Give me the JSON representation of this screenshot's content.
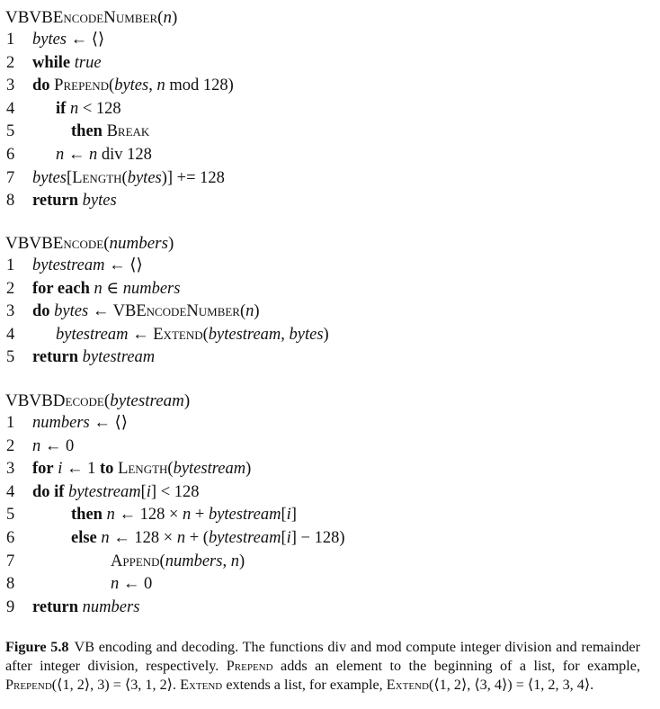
{
  "algorithms": [
    {
      "title_name": "VBEncodeNumber",
      "title_arg": "n",
      "lines": [
        {
          "num": "1",
          "indent": 0,
          "parts": [
            {
              "t": "bytes",
              "s": "it"
            },
            {
              "t": " ← ⟨⟩",
              "s": ""
            }
          ]
        },
        {
          "num": "2",
          "indent": 0,
          "parts": [
            {
              "t": "while",
              "s": "kw"
            },
            {
              "t": " ",
              "s": ""
            },
            {
              "t": "true",
              "s": "it"
            }
          ]
        },
        {
          "num": "3",
          "indent": 0,
          "parts": [
            {
              "t": "do",
              "s": "kw"
            },
            {
              "t": " ",
              "s": ""
            },
            {
              "t": "Prepend",
              "s": "sc"
            },
            {
              "t": "(",
              "s": ""
            },
            {
              "t": "bytes",
              "s": "it"
            },
            {
              "t": ", ",
              "s": ""
            },
            {
              "t": "n",
              "s": "it"
            },
            {
              "t": " mod 128)",
              "s": ""
            }
          ]
        },
        {
          "num": "4",
          "indent": 1,
          "parts": [
            {
              "t": "if",
              "s": "kw"
            },
            {
              "t": " ",
              "s": ""
            },
            {
              "t": "n",
              "s": "it"
            },
            {
              "t": " < 128",
              "s": ""
            }
          ]
        },
        {
          "num": "5",
          "indent": 2,
          "parts": [
            {
              "t": "then",
              "s": "kw"
            },
            {
              "t": " ",
              "s": ""
            },
            {
              "t": "Break",
              "s": "sc"
            }
          ]
        },
        {
          "num": "6",
          "indent": 1,
          "parts": [
            {
              "t": "n",
              "s": "it"
            },
            {
              "t": " ← ",
              "s": ""
            },
            {
              "t": "n",
              "s": "it"
            },
            {
              "t": " div 128",
              "s": ""
            }
          ]
        },
        {
          "num": "7",
          "indent": 0,
          "parts": [
            {
              "t": "bytes",
              "s": "it"
            },
            {
              "t": "[",
              "s": ""
            },
            {
              "t": "Length",
              "s": "sc"
            },
            {
              "t": "(",
              "s": ""
            },
            {
              "t": "bytes",
              "s": "it"
            },
            {
              "t": ")] += 128",
              "s": ""
            }
          ]
        },
        {
          "num": "8",
          "indent": 0,
          "parts": [
            {
              "t": "return",
              "s": "kw"
            },
            {
              "t": " ",
              "s": ""
            },
            {
              "t": "bytes",
              "s": "it"
            }
          ]
        }
      ]
    },
    {
      "title_name": "VBEncode",
      "title_arg": "numbers",
      "lines": [
        {
          "num": "1",
          "indent": 0,
          "parts": [
            {
              "t": "bytestream",
              "s": "it"
            },
            {
              "t": " ← ⟨⟩",
              "s": ""
            }
          ]
        },
        {
          "num": "2",
          "indent": 0,
          "parts": [
            {
              "t": "for each",
              "s": "kw"
            },
            {
              "t": " ",
              "s": ""
            },
            {
              "t": "n",
              "s": "it"
            },
            {
              "t": " ∈ ",
              "s": ""
            },
            {
              "t": "numbers",
              "s": "it"
            }
          ]
        },
        {
          "num": "3",
          "indent": 0,
          "parts": [
            {
              "t": "do",
              "s": "kw"
            },
            {
              "t": " ",
              "s": ""
            },
            {
              "t": "bytes",
              "s": "it"
            },
            {
              "t": " ← VB",
              "s": ""
            },
            {
              "t": "EncodeNumber",
              "s": "sc"
            },
            {
              "t": "(",
              "s": ""
            },
            {
              "t": "n",
              "s": "it"
            },
            {
              "t": ")",
              "s": ""
            }
          ]
        },
        {
          "num": "4",
          "indent": 1,
          "parts": [
            {
              "t": "bytestream",
              "s": "it"
            },
            {
              "t": " ← ",
              "s": ""
            },
            {
              "t": "Extend",
              "s": "sc"
            },
            {
              "t": "(",
              "s": ""
            },
            {
              "t": "bytestream",
              "s": "it"
            },
            {
              "t": ", ",
              "s": ""
            },
            {
              "t": "bytes",
              "s": "it"
            },
            {
              "t": ")",
              "s": ""
            }
          ]
        },
        {
          "num": "5",
          "indent": 0,
          "parts": [
            {
              "t": "return",
              "s": "kw"
            },
            {
              "t": " ",
              "s": ""
            },
            {
              "t": "bytestream",
              "s": "it"
            }
          ]
        }
      ]
    },
    {
      "title_name": "VBDecode",
      "title_arg": "bytestream",
      "lines": [
        {
          "num": "1",
          "indent": 0,
          "parts": [
            {
              "t": "numbers",
              "s": "it"
            },
            {
              "t": " ← ⟨⟩",
              "s": ""
            }
          ]
        },
        {
          "num": "2",
          "indent": 0,
          "parts": [
            {
              "t": "n",
              "s": "it"
            },
            {
              "t": " ← 0",
              "s": ""
            }
          ]
        },
        {
          "num": "3",
          "indent": 0,
          "parts": [
            {
              "t": "for",
              "s": "kw"
            },
            {
              "t": " ",
              "s": ""
            },
            {
              "t": "i",
              "s": "it"
            },
            {
              "t": " ← 1 ",
              "s": ""
            },
            {
              "t": "to",
              "s": "kw"
            },
            {
              "t": " ",
              "s": ""
            },
            {
              "t": "Length",
              "s": "sc"
            },
            {
              "t": "(",
              "s": ""
            },
            {
              "t": "bytestream",
              "s": "it"
            },
            {
              "t": ")",
              "s": ""
            }
          ]
        },
        {
          "num": "4",
          "indent": 0,
          "parts": [
            {
              "t": "do if",
              "s": "kw"
            },
            {
              "t": " ",
              "s": ""
            },
            {
              "t": "bytestream",
              "s": "it"
            },
            {
              "t": "[",
              "s": ""
            },
            {
              "t": "i",
              "s": "it"
            },
            {
              "t": "] < 128",
              "s": ""
            }
          ]
        },
        {
          "num": "5",
          "indent": 2,
          "parts": [
            {
              "t": "then",
              "s": "kw"
            },
            {
              "t": " ",
              "s": ""
            },
            {
              "t": "n",
              "s": "it"
            },
            {
              "t": " ← 128 × ",
              "s": ""
            },
            {
              "t": "n",
              "s": "it"
            },
            {
              "t": " + ",
              "s": ""
            },
            {
              "t": "bytestream",
              "s": "it"
            },
            {
              "t": "[",
              "s": ""
            },
            {
              "t": "i",
              "s": "it"
            },
            {
              "t": "]",
              "s": ""
            }
          ]
        },
        {
          "num": "6",
          "indent": 2,
          "parts": [
            {
              "t": "else",
              "s": "kw"
            },
            {
              "t": " ",
              "s": ""
            },
            {
              "t": "n",
              "s": "it"
            },
            {
              "t": " ← 128 × ",
              "s": ""
            },
            {
              "t": "n",
              "s": "it"
            },
            {
              "t": " + (",
              "s": ""
            },
            {
              "t": "bytestream",
              "s": "it"
            },
            {
              "t": "[",
              "s": ""
            },
            {
              "t": "i",
              "s": "it"
            },
            {
              "t": "] − 128)",
              "s": ""
            }
          ]
        },
        {
          "num": "7",
          "indent": 3,
          "parts": [
            {
              "t": "Append",
              "s": "sc"
            },
            {
              "t": "(",
              "s": ""
            },
            {
              "t": "numbers",
              "s": "it"
            },
            {
              "t": ", ",
              "s": ""
            },
            {
              "t": "n",
              "s": "it"
            },
            {
              "t": ")",
              "s": ""
            }
          ]
        },
        {
          "num": "8",
          "indent": 3,
          "parts": [
            {
              "t": "n",
              "s": "it"
            },
            {
              "t": " ← 0",
              "s": ""
            }
          ]
        },
        {
          "num": "9",
          "indent": 0,
          "parts": [
            {
              "t": "return",
              "s": "kw"
            },
            {
              "t": " ",
              "s": ""
            },
            {
              "t": "numbers",
              "s": "it"
            }
          ]
        }
      ]
    }
  ],
  "caption": {
    "label": "Figure 5.8",
    "parts": [
      {
        "t": "VB encoding and decoding. The functions div and mod compute integer division and remainder after integer division, respectively. ",
        "s": ""
      },
      {
        "t": "Prepend",
        "s": "sc"
      },
      {
        "t": " adds an element to the beginning of a list, for example, ",
        "s": ""
      },
      {
        "t": "Prepend",
        "s": "sc"
      },
      {
        "t": "(⟨1, 2⟩, 3) = ⟨3, 1, 2⟩. ",
        "s": ""
      },
      {
        "t": "Extend",
        "s": "sc"
      },
      {
        "t": " extends a list, for example, ",
        "s": ""
      },
      {
        "t": "Extend",
        "s": "sc"
      },
      {
        "t": "(⟨1, 2⟩, ⟨3, 4⟩) = ⟨1, 2, 3, 4⟩.",
        "s": ""
      }
    ]
  }
}
